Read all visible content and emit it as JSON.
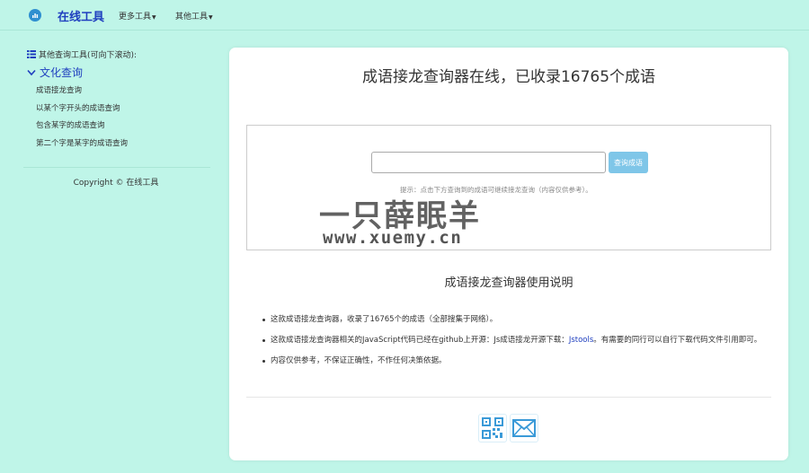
{
  "navbar": {
    "brand": "在线工具",
    "items": [
      {
        "label": "更多工具"
      },
      {
        "label": "其他工具"
      }
    ]
  },
  "sidebar": {
    "header": "其他查询工具(可向下滚动):",
    "section": "文化查询",
    "links": [
      {
        "label": "成语接龙查询"
      },
      {
        "label": "以某个字开头的成语查询"
      },
      {
        "label": "包含某字的成语查询"
      },
      {
        "label": "第二个字是某字的成语查询"
      }
    ],
    "copyright": "Copyright © 在线工具"
  },
  "main": {
    "title": "成语接龙查询器在线，已收录16765个成语",
    "search": {
      "placeholder": "",
      "value": "",
      "button_label": "查询成语"
    },
    "hint": "提示：点击下方查询到的成语可继续接龙查询（内容仅供参考）。",
    "watermark": "一只薛眠羊",
    "watermark_url": "www.xuemy.cn",
    "usage_title": "成语接龙查询器使用说明",
    "notes": {
      "n1": "这款成语接龙查询器，收录了16765个的成语（全部搜集于网络）。",
      "n2_pre": "这款成语接龙查询器相关的JavaScript代码已经在github上开源：Js成语接龙开源下载：",
      "n2_link": "Jstools",
      "n2_post": "。有需要的同行可以自行下载代码文件引用即可。",
      "n3": "内容仅供参考，不保证正确性，不作任何决策依据。"
    }
  },
  "colors": {
    "background": "#bff5e8",
    "brand": "#1f3fbf",
    "button": "#7fc6e8"
  },
  "icons": [
    "logo-icon",
    "list-icon",
    "chevron-down-icon",
    "qrcode-icon",
    "mail-icon"
  ]
}
